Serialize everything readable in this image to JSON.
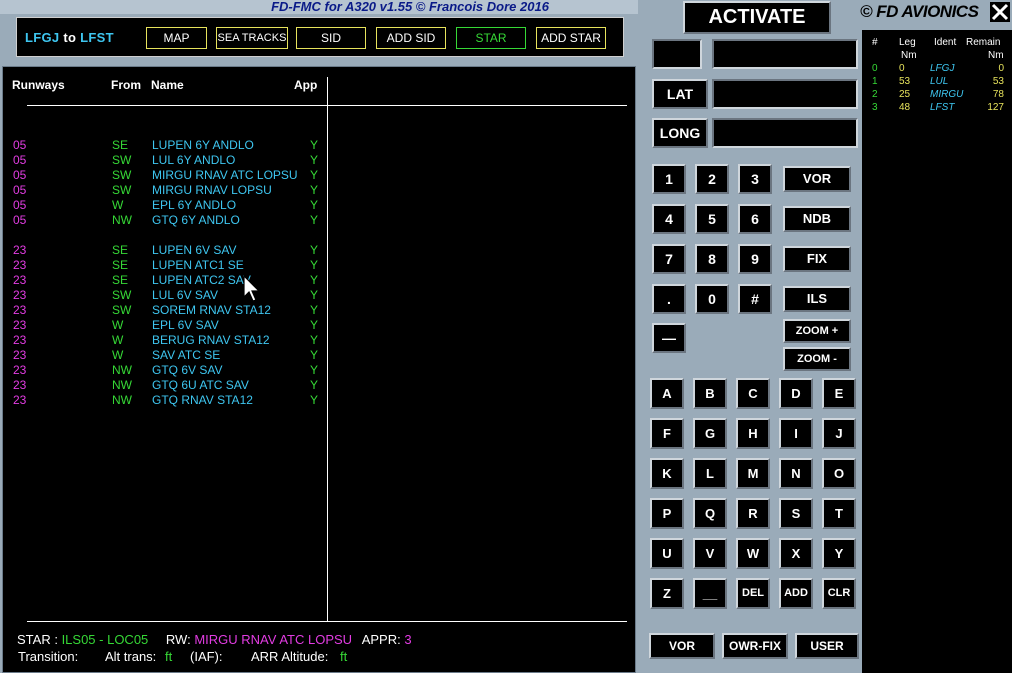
{
  "title": "FD-FMC for A320 v1.55 © Francois Dore 2016",
  "route": {
    "dep": "LFGJ",
    "to": "to",
    "arr": "LFST"
  },
  "top_buttons": [
    "MAP",
    "SEA TRACKS",
    "SID",
    "ADD SID",
    "STAR",
    "ADD STAR"
  ],
  "columns": {
    "runways": "Runways",
    "from": "From",
    "name": "Name",
    "app": "App"
  },
  "procedures": [
    {
      "rw": "05",
      "from": "SE",
      "name": "LUPEN 6Y ANDLO",
      "app": "Y"
    },
    {
      "rw": "05",
      "from": "SW",
      "name": "LUL 6Y ANDLO",
      "app": "Y"
    },
    {
      "rw": "05",
      "from": "SW",
      "name": "MIRGU RNAV ATC LOPSU",
      "app": "Y"
    },
    {
      "rw": "05",
      "from": "SW",
      "name": "MIRGU RNAV LOPSU",
      "app": "Y"
    },
    {
      "rw": "05",
      "from": "W",
      "name": "EPL 6Y ANDLO",
      "app": "Y"
    },
    {
      "rw": "05",
      "from": "NW",
      "name": "GTQ 6Y ANDLO",
      "app": "Y"
    },
    {
      "rw": "23",
      "from": "SE",
      "name": "LUPEN 6V SAV",
      "app": "Y"
    },
    {
      "rw": "23",
      "from": "SE",
      "name": "LUPEN ATC1 SE",
      "app": "Y"
    },
    {
      "rw": "23",
      "from": "SE",
      "name": "LUPEN ATC2 SAV",
      "app": "Y"
    },
    {
      "rw": "23",
      "from": "SW",
      "name": "LUL 6V SAV",
      "app": "Y"
    },
    {
      "rw": "23",
      "from": "SW",
      "name": "SOREM RNAV STA12",
      "app": "Y"
    },
    {
      "rw": "23",
      "from": "W",
      "name": "EPL 6V SAV",
      "app": "Y"
    },
    {
      "rw": "23",
      "from": "W",
      "name": "BERUG RNAV STA12",
      "app": "Y"
    },
    {
      "rw": "23",
      "from": "W",
      "name": "SAV ATC SE",
      "app": "Y"
    },
    {
      "rw": "23",
      "from": "NW",
      "name": "GTQ 6V SAV",
      "app": "Y"
    },
    {
      "rw": "23",
      "from": "NW",
      "name": "GTQ 6U ATC SAV",
      "app": "Y"
    },
    {
      "rw": "23",
      "from": "NW",
      "name": "GTQ RNAV STA12",
      "app": "Y"
    }
  ],
  "status": {
    "star_label": "STAR :",
    "star_value": "ILS05 - LOC05",
    "rw_label": "RW:",
    "rw_value": "MIRGU RNAV ATC LOPSU",
    "appr_label": "APPR:",
    "appr_value": "3",
    "transition_label": "Transition:",
    "alt_trans_label": "Alt trans:",
    "alt_trans_unit": "ft",
    "iaf_label": "(IAF):",
    "arr_alt_label": "ARR Altitude:",
    "arr_alt_unit": "ft"
  },
  "activate": "ACTIVATE",
  "brand": "© FD AVIONICS",
  "lat_label": "LAT",
  "long_label": "LONG",
  "digit_keys": [
    "1",
    "2",
    "3",
    "4",
    "5",
    "6",
    "7",
    "8",
    "9",
    ".",
    "0",
    "#",
    "—"
  ],
  "nav_keys": [
    "VOR",
    "NDB",
    "FIX",
    "ILS",
    "ZOOM +",
    "ZOOM -"
  ],
  "alpha_keys": [
    "A",
    "B",
    "C",
    "D",
    "E",
    "F",
    "G",
    "H",
    "I",
    "J",
    "K",
    "L",
    "M",
    "N",
    "O",
    "P",
    "Q",
    "R",
    "S",
    "T",
    "U",
    "V",
    "W",
    "X",
    "Y",
    "Z",
    "__",
    "DEL",
    "ADD",
    "CLR"
  ],
  "bottom_keys": [
    "VOR",
    "OWR-FIX",
    "USER"
  ],
  "legs": {
    "headers": {
      "num": "#",
      "leg": "Leg",
      "leg_unit": "Nm",
      "ident": "Ident",
      "remain": "Remain",
      "remain_unit": "Nm"
    },
    "rows": [
      {
        "num": "0",
        "leg": "0",
        "ident": "LFGJ",
        "remain": "0"
      },
      {
        "num": "1",
        "leg": "53",
        "ident": "LUL",
        "remain": "53"
      },
      {
        "num": "2",
        "leg": "25",
        "ident": "MIRGU",
        "remain": "78"
      },
      {
        "num": "3",
        "leg": "48",
        "ident": "LFST",
        "remain": "127"
      }
    ]
  },
  "colors": {
    "cyan": "#3ec6f0",
    "green": "#36d836",
    "magenta": "#e23ce2",
    "yellow": "#e7e35c"
  }
}
